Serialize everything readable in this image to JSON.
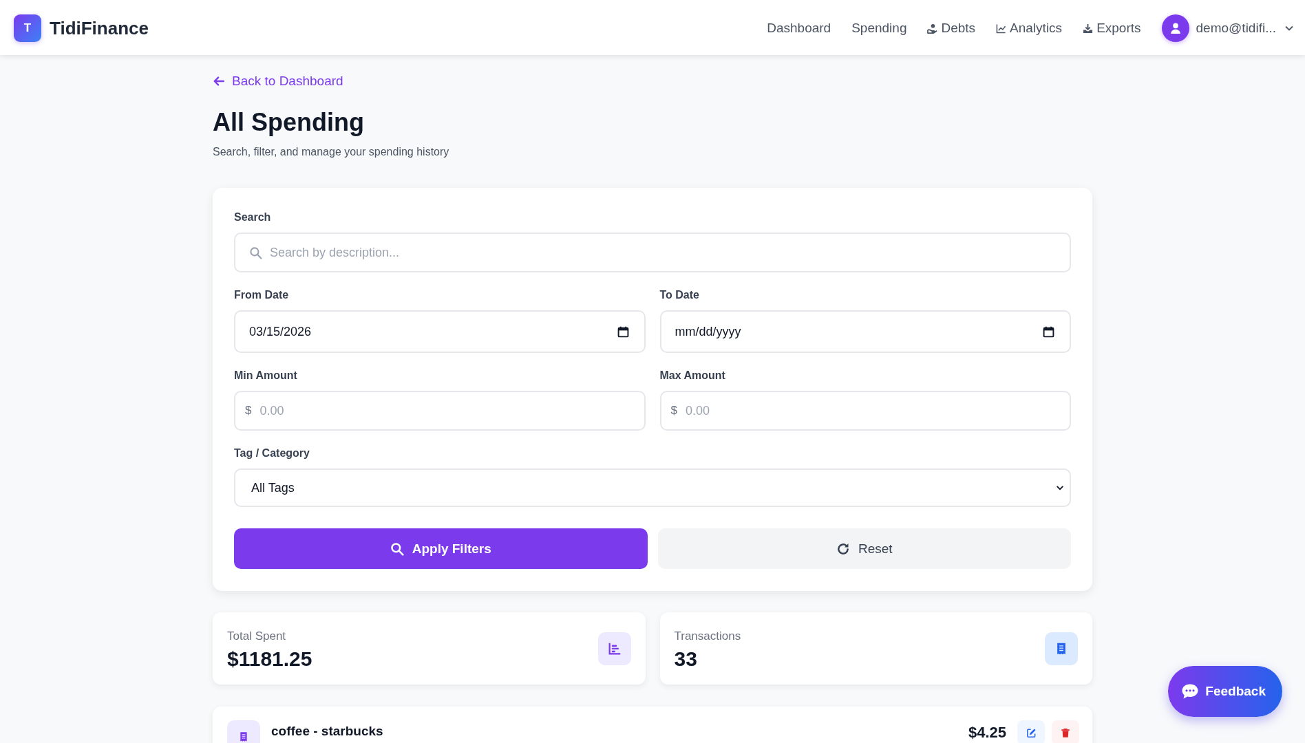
{
  "header": {
    "logo_letter": "T",
    "brand": "TidiFinance",
    "nav": [
      {
        "label": "Dashboard"
      },
      {
        "label": "Spending"
      },
      {
        "label": "Debts"
      },
      {
        "label": "Analytics"
      },
      {
        "label": "Exports"
      }
    ],
    "user": {
      "email": "demo@tidifi..."
    }
  },
  "page": {
    "back_link": "Back to Dashboard",
    "title": "All Spending",
    "subtitle": "Search, filter, and manage your spending history"
  },
  "filters": {
    "search": {
      "label": "Search",
      "placeholder": "Search by description..."
    },
    "from_date": {
      "label": "From Date",
      "value": "03/15/2026"
    },
    "to_date": {
      "label": "To Date",
      "placeholder": "mm/dd/yyyy"
    },
    "min_amount": {
      "label": "Min Amount",
      "prefix": "$",
      "placeholder": "0.00"
    },
    "max_amount": {
      "label": "Max Amount",
      "prefix": "$",
      "placeholder": "0.00"
    },
    "tag": {
      "label": "Tag / Category",
      "value": "All Tags"
    },
    "apply_button": "Apply Filters",
    "reset_button": "Reset"
  },
  "stats": [
    {
      "label": "Total Spent",
      "value": "$1181.25"
    },
    {
      "label": "Transactions",
      "value": "33"
    }
  ],
  "transactions": [
    {
      "description": "coffee - starbucks",
      "amount": "$4.25"
    }
  ],
  "feedback_button": "Feedback"
}
